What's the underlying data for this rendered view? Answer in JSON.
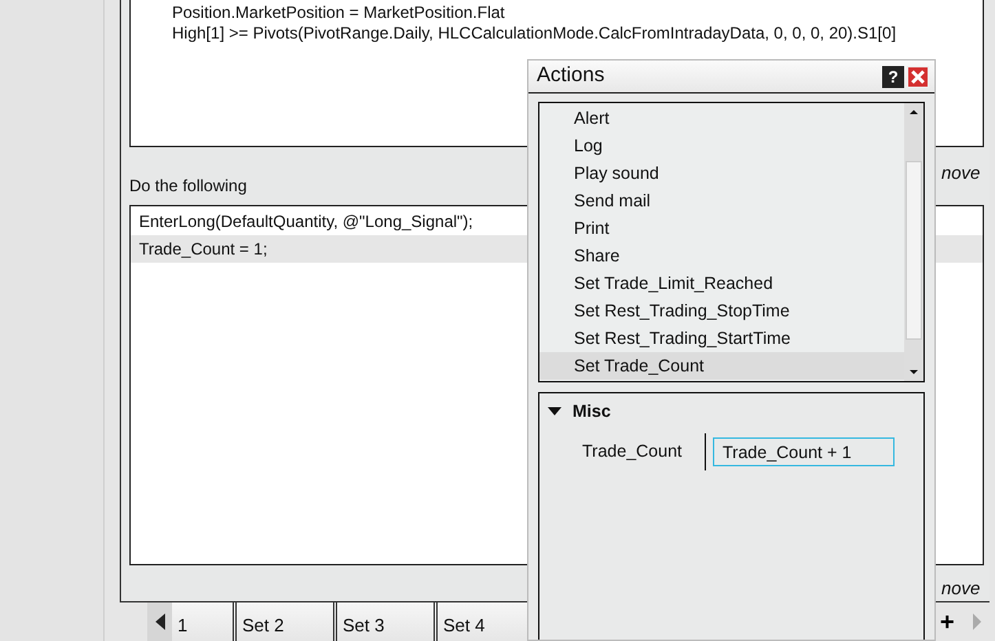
{
  "condition_lines": [
    "Position.MarketPosition = MarketPosition.Flat",
    "High[1] >= Pivots(PivotRange.Daily, HLCCalculationMode.CalcFromIntradayData, 0, 0, 0, 20).S1[0]"
  ],
  "remove_links": [
    "nove",
    "nove"
  ],
  "actions_label": "Do the following",
  "actions": [
    {
      "text": "EnterLong(DefaultQuantity, @\"Long_Signal\");",
      "selected": false
    },
    {
      "text": "Trade_Count = 1;",
      "selected": true
    }
  ],
  "set_tabs": [
    "1",
    "Set 2",
    "Set 3",
    "Set 4"
  ],
  "add_tab": "+",
  "dialog": {
    "title": "Actions",
    "help": "?",
    "items": [
      {
        "label": "Alert",
        "selected": false
      },
      {
        "label": "Log",
        "selected": false
      },
      {
        "label": "Play sound",
        "selected": false
      },
      {
        "label": "Send mail",
        "selected": false
      },
      {
        "label": "Print",
        "selected": false
      },
      {
        "label": "Share",
        "selected": false
      },
      {
        "label": "Set Trade_Limit_Reached",
        "selected": false
      },
      {
        "label": "Set Rest_Trading_StopTime",
        "selected": false
      },
      {
        "label": "Set Rest_Trading_StartTime",
        "selected": false
      },
      {
        "label": "Set Trade_Count",
        "selected": true
      }
    ],
    "category": {
      "label": "Misc",
      "expanded": true,
      "properties": [
        {
          "name": "Trade_Count",
          "value": "Trade_Count + 1"
        }
      ]
    }
  }
}
